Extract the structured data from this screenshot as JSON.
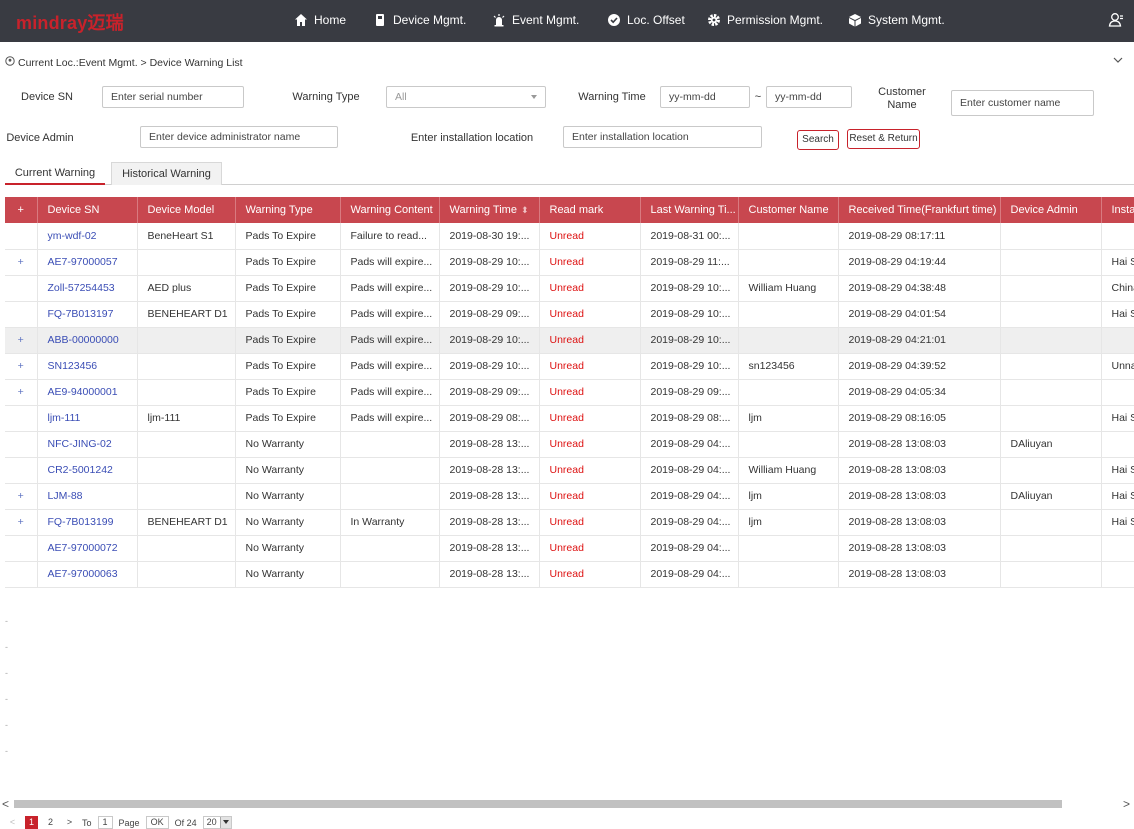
{
  "brand": {
    "logo_text": "mindray迈瑞",
    "color": "#c8222b"
  },
  "nav": {
    "home": "Home",
    "device": "Device Mgmt.",
    "event": "Event Mgmt.",
    "loc": "Loc. Offset",
    "permission": "Permission Mgmt.",
    "system": "System Mgmt."
  },
  "breadcrumb": "Current Loc.:Event Mgmt. > Device Warning List",
  "filters": {
    "device_sn_label": "Device SN",
    "device_sn_placeholder": "Enter serial number",
    "warning_type_label": "Warning Type",
    "warning_type_value": "All",
    "warning_time_label": "Warning Time",
    "date_from_placeholder": "yy-mm-dd",
    "date_sep": "~",
    "date_to_placeholder": "yy-mm-dd",
    "customer_label": "Customer Name",
    "customer_placeholder": "Enter customer name",
    "admin_label": "Device Admin",
    "admin_placeholder": "Enter device administrator name",
    "location_label": "Enter installation location",
    "location_placeholder": "Enter installation location",
    "search_btn": "Search",
    "reset_btn": "Reset & Return"
  },
  "tabs": {
    "current": "Current Warning",
    "historical": "Historical Warning"
  },
  "table": {
    "headers": [
      "+",
      "Device SN",
      "Device Model",
      "Warning Type",
      "Warning Content",
      "Warning Time",
      "Read mark",
      "Last Warning Ti...",
      "Customer Name",
      "Received Time(Frankfurt time)",
      "Device Admin",
      "Install"
    ],
    "rows": [
      [
        "",
        "ym-wdf-02",
        "BeneHeart S1",
        "Pads To Expire",
        "Failure to read...",
        "2019-08-30 19:...",
        "Unread",
        "2019-08-31 00:...",
        "",
        "2019-08-29 08:17:11",
        "",
        ""
      ],
      [
        "+",
        "AE7-97000057",
        "",
        "Pads To Expire",
        "Pads will expire...",
        "2019-08-29 10:...",
        "Unread",
        "2019-08-29 11:...",
        "",
        "2019-08-29 04:19:44",
        "",
        "Hai Si"
      ],
      [
        "",
        "Zoll-57254453",
        "AED plus",
        "Pads To Expire",
        "Pads will expire...",
        "2019-08-29 10:...",
        "Unread",
        "2019-08-29 10:...",
        "William Huang",
        "2019-08-29 04:38:48",
        "",
        "China,"
      ],
      [
        "",
        "FQ-7B013197",
        "BENEHEART D1",
        "Pads To Expire",
        "Pads will expire...",
        "2019-08-29 09:...",
        "Unread",
        "2019-08-29 10:...",
        "",
        "2019-08-29 04:01:54",
        "",
        "Hai Si"
      ],
      [
        "+",
        "ABB-00000000",
        "",
        "Pads To Expire",
        "Pads will expire...",
        "2019-08-29 10:...",
        "Unread",
        "2019-08-29 10:...",
        "",
        "2019-08-29 04:21:01",
        "",
        ""
      ],
      [
        "+",
        "SN123456",
        "",
        "Pads To Expire",
        "Pads will expire...",
        "2019-08-29 10:...",
        "Unread",
        "2019-08-29 10:...",
        "sn123456",
        "2019-08-29 04:39:52",
        "",
        "Unnar"
      ],
      [
        "+",
        "AE9-94000001",
        "",
        "Pads To Expire",
        "Pads will expire...",
        "2019-08-29 09:...",
        "Unread",
        "2019-08-29 09:...",
        "",
        "2019-08-29 04:05:34",
        "",
        ""
      ],
      [
        "",
        "ljm-111",
        "ljm-111",
        "Pads To Expire",
        "Pads will expire...",
        "2019-08-29 08:...",
        "Unread",
        "2019-08-29 08:...",
        "ljm",
        "2019-08-29 08:16:05",
        "",
        "Hai Si"
      ],
      [
        "",
        "NFC-JING-02",
        "",
        "No Warranty",
        "",
        "2019-08-28 13:...",
        "Unread",
        "2019-08-29 04:...",
        "",
        "2019-08-28 13:08:03",
        "DAliuyan",
        ""
      ],
      [
        "",
        "CR2-5001242",
        "",
        "No Warranty",
        "",
        "2019-08-28 13:...",
        "Unread",
        "2019-08-29 04:...",
        "William Huang",
        "2019-08-28 13:08:03",
        "",
        "Hai Si"
      ],
      [
        "+",
        "LJM-88",
        "",
        "No Warranty",
        "",
        "2019-08-28 13:...",
        "Unread",
        "2019-08-29 04:...",
        "ljm",
        "2019-08-28 13:08:03",
        "DAliuyan",
        "Hai Si"
      ],
      [
        "+",
        "FQ-7B013199",
        "BENEHEART D1",
        "No Warranty",
        "In Warranty",
        "2019-08-28 13:...",
        "Unread",
        "2019-08-29 04:...",
        "ljm",
        "2019-08-28 13:08:03",
        "",
        "Hai Si"
      ],
      [
        "",
        "AE7-97000072",
        "",
        "No Warranty",
        "",
        "2019-08-28 13:...",
        "Unread",
        "2019-08-29 04:...",
        "",
        "2019-08-28 13:08:03",
        "",
        ""
      ],
      [
        "",
        "AE7-97000063",
        "",
        "No Warranty",
        "",
        "2019-08-28 13:...",
        "Unread",
        "2019-08-29 04:...",
        "",
        "2019-08-28 13:08:03",
        "",
        ""
      ]
    ]
  },
  "pagination": {
    "prev": "<",
    "page1": "1",
    "page2": "2",
    "next": ">",
    "to_label": "To",
    "page_input": "1",
    "page_label": "Page",
    "ok": "OK",
    "of_label": "Of 24",
    "size": "20"
  },
  "scroll": {
    "left": "<",
    "right": ">"
  }
}
